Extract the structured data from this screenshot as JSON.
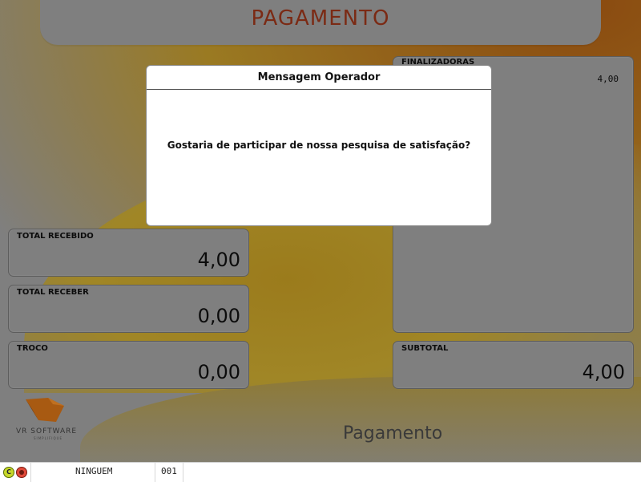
{
  "header": {
    "title": "PAGAMENTO"
  },
  "panels": {
    "finalizadoras": {
      "label": "FINALIZADORAS",
      "value": "4,00"
    },
    "total_recebido": {
      "label": "TOTAL RECEBIDO",
      "value": "4,00"
    },
    "total_receber": {
      "label": "TOTAL RECEBER",
      "value": "0,00"
    },
    "troco": {
      "label": "TROCO",
      "value": "0,00"
    },
    "subtotal": {
      "label": "SUBTOTAL",
      "value": "4,00"
    }
  },
  "logo": {
    "name": "VR SOFTWARE",
    "tagline": "SIMPLIFIQUE"
  },
  "footer": {
    "title": "Pagamento"
  },
  "statusbar": {
    "c_icon_letter": "C",
    "operator": "NINGUEM",
    "terminal": "001"
  },
  "modal": {
    "title": "Mensagem Operador",
    "message": "Gostaria de participar de nossa pesquisa de satisfação?"
  },
  "colors": {
    "accent": "#7b2a14",
    "status_green": "#c7d82a",
    "status_red": "#e24a3a"
  }
}
